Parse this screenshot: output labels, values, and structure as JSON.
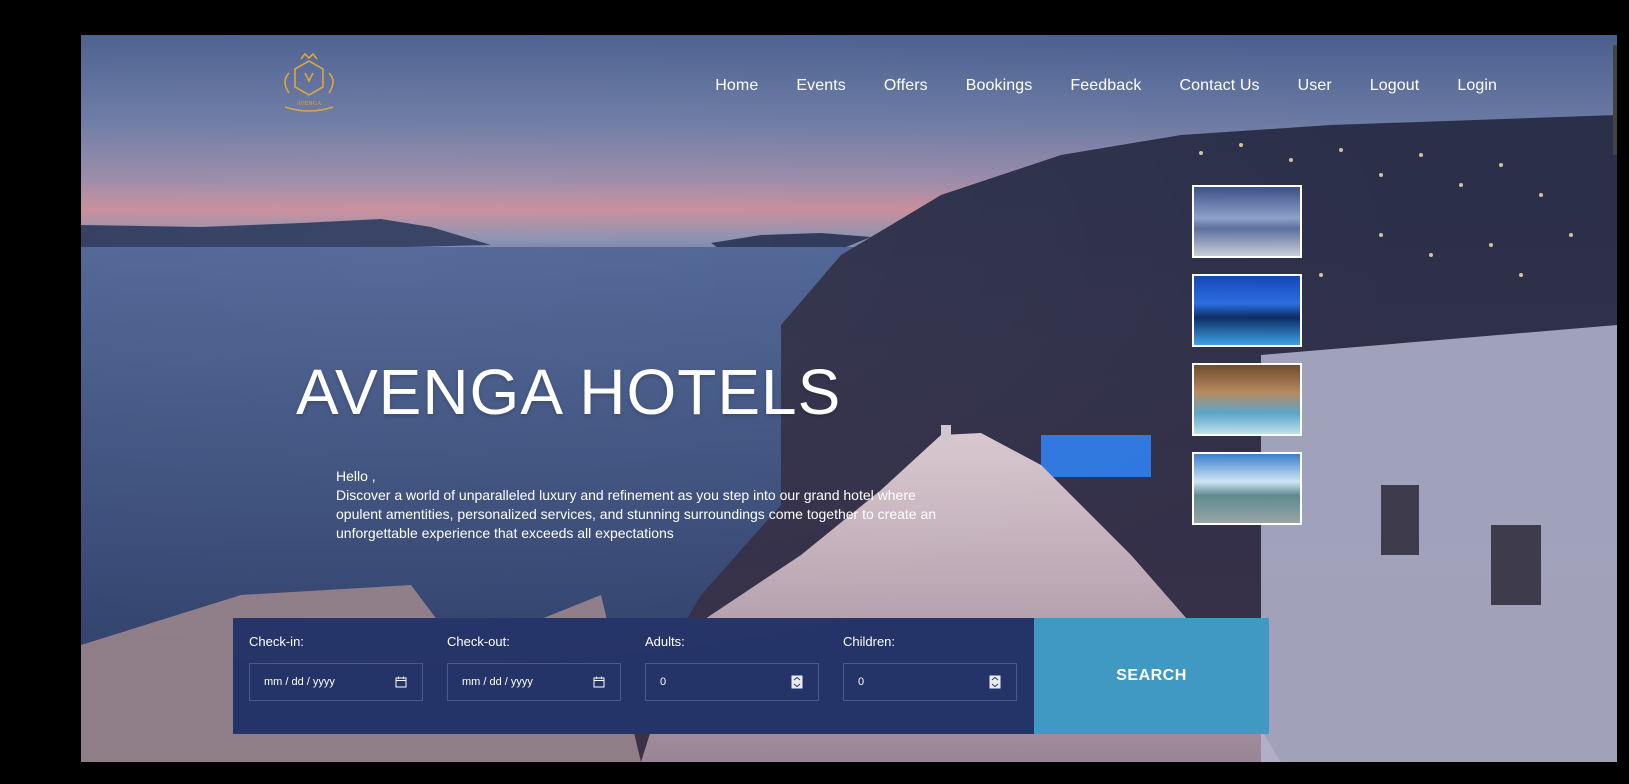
{
  "nav": {
    "items": [
      "Home",
      "Events",
      "Offers",
      "Bookings",
      "Feedback",
      "Contact Us",
      "User",
      "Logout",
      "Login"
    ]
  },
  "hero": {
    "title": "AVENGA HOTELS",
    "greeting": "Hello ,",
    "description": "Discover a world of unparalleled luxury and refinement as you step into our grand hotel where opulent amentities, personalized services, and stunning surroundings come together to create an unforgettable experience that exceeds all expectations"
  },
  "booking": {
    "checkin_label": "Check-in:",
    "checkout_label": "Check-out:",
    "adults_label": "Adults:",
    "children_label": "Children:",
    "date_placeholder": "mm / dd / yyyy",
    "adults_value": "0",
    "children_value": "0",
    "search_label": "SEARCH"
  },
  "colors": {
    "panel": "#253468",
    "search": "#3f99c3"
  }
}
